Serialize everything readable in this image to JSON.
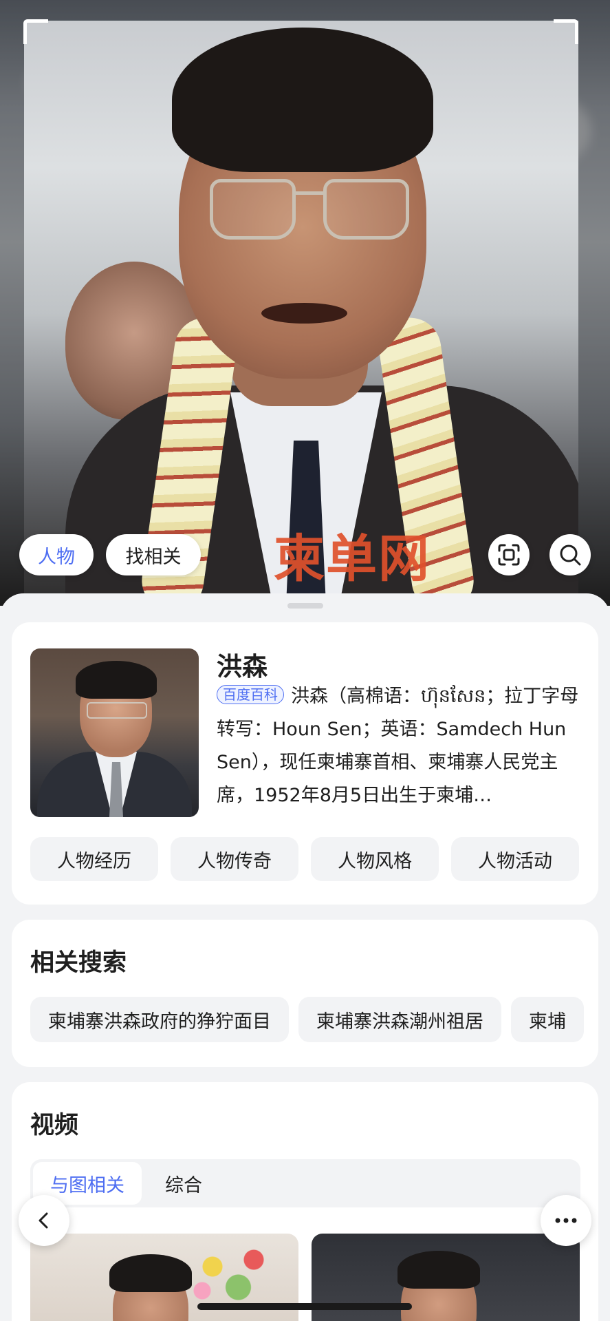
{
  "photo": {
    "watermark": "柬单网",
    "chips": [
      {
        "label": "人物",
        "active": true
      },
      {
        "label": "找相关",
        "active": false
      }
    ],
    "icons": [
      "scan-icon",
      "search-icon"
    ]
  },
  "baike": {
    "title": "洪森",
    "source_badge": "百度百科",
    "description": "洪森（高棉语：ហ៊ុនសែន；拉丁字母转写：Houn Sen；英语：Samdech Hun Sen），现任柬埔寨首相、柬埔寨人民党主席，1952年8月5日出生于柬埔…",
    "tags": [
      "人物经历",
      "人物传奇",
      "人物风格",
      "人物活动"
    ]
  },
  "related_search": {
    "title": "相关搜索",
    "items": [
      "柬埔寨洪森政府的狰狞面目",
      "柬埔寨洪森潮州祖居",
      "柬埔"
    ]
  },
  "video": {
    "title": "视频",
    "tabs": [
      {
        "label": "与图相关",
        "active": true
      },
      {
        "label": "综合",
        "active": false
      }
    ]
  },
  "floating": {
    "back_icon": "chevron-left-icon",
    "more_icon": "more-horizontal-icon"
  },
  "colors": {
    "accent": "#4e6ef2",
    "watermark": "#e0512c",
    "background": "#f2f3f5"
  }
}
